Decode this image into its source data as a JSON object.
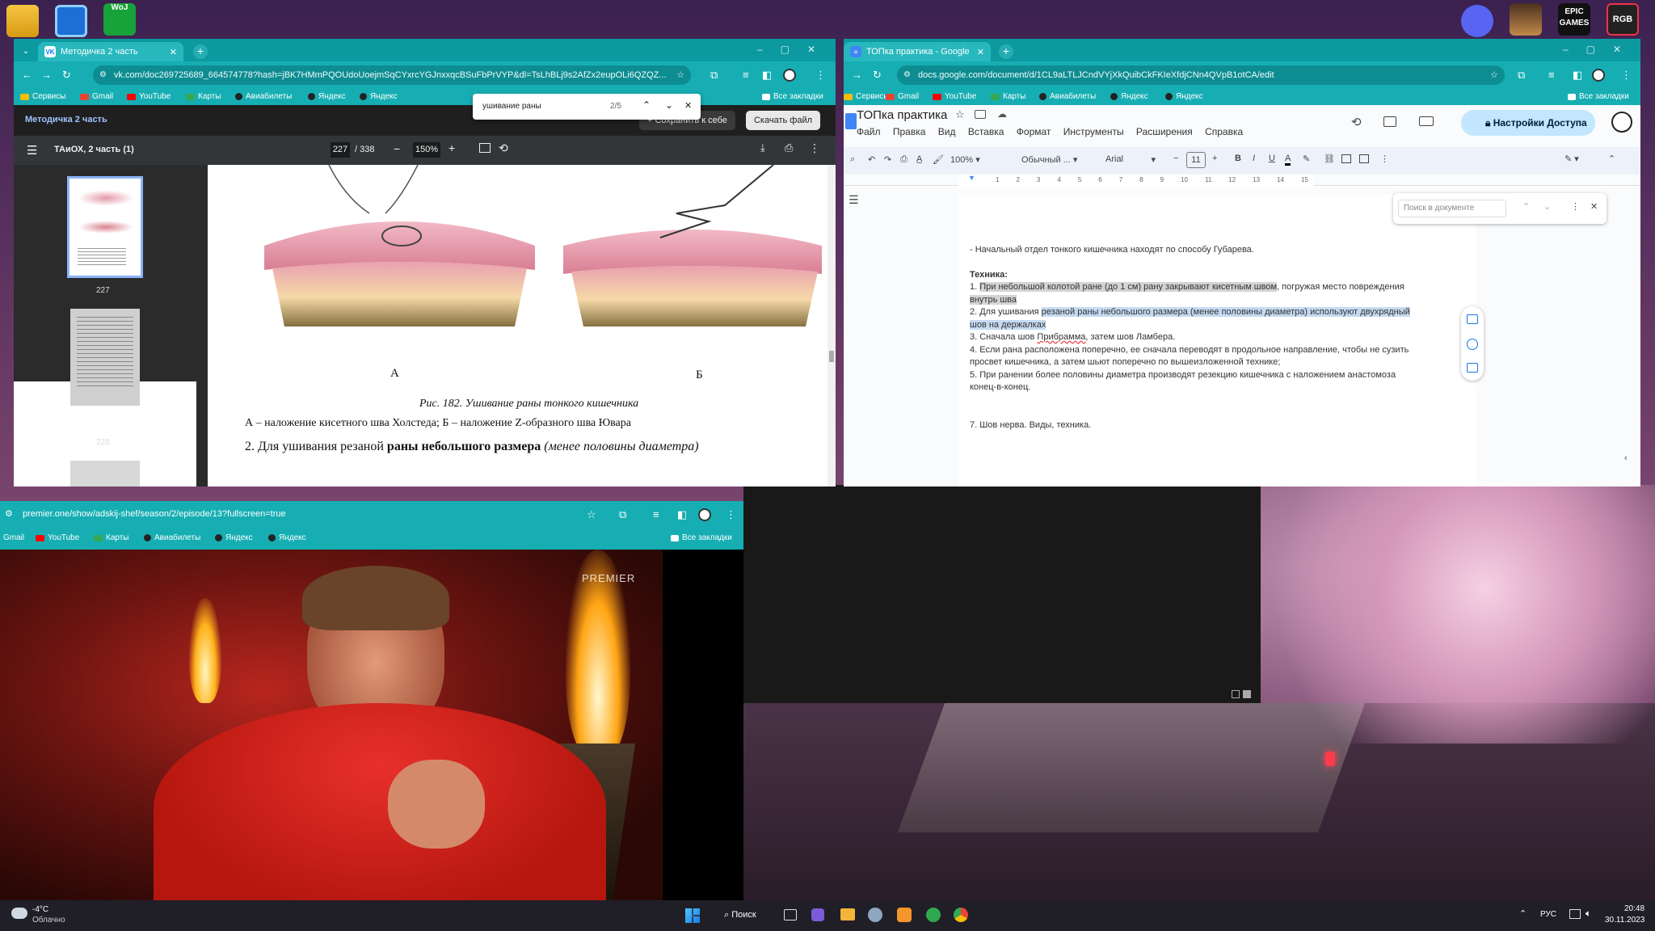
{
  "desktop": {
    "icons": [
      "folder-icon",
      "monitor-icon",
      "woj-icon",
      "discord-icon",
      "avatar-icon",
      "epic-icon",
      "rgb-icon"
    ],
    "woj_label": "WoJ",
    "epic_label": "EPIC GAMES",
    "rgb_label": "RGB"
  },
  "left_window": {
    "tab_title": "Методичка 2 часть",
    "url": "vk.com/doc269725689_664574778?hash=jBK7HMmPQOUdoUoejmSqCYxrcYGJnxxqcBSuFbPrVYP&dl=TsLhBLj9s2AfZx2eupOLi6QZQZ...",
    "bookmarks": [
      "Сервисы",
      "Gmail",
      "YouTube",
      "Карты",
      "Авиабилеты",
      "Яндекс",
      "Яндекс"
    ],
    "all_bookmarks": "Все закладки",
    "find_query": "ушивание раны",
    "find_count": "2/5",
    "doc_title": "Методичка 2 часть",
    "save_btn": "Сохранить к себе",
    "download_btn": "Скачать файл",
    "pdf_name": "ТАиОХ, 2 часть (1)",
    "page_current": "227",
    "page_total": "/ 338",
    "zoom": "150%",
    "thumbs": [
      "227",
      "228"
    ],
    "figure_label_a": "А",
    "figure_label_b": "Б",
    "caption": "Рис. 182. Ушивание раны тонкого кишечника",
    "caption_line": "А – наложение кисетного шва Холстеда; Б – наложение Z-образного шва Ювара",
    "cut_line_1": "2.   Для ушивания резаной ",
    "cut_line_bold": "раны небольшого размера",
    "cut_line_2": " (менее половины диаметра)"
  },
  "right_window": {
    "tab_title": "ТОПка практика - Google До...",
    "url": "docs.google.com/document/d/1CL9aLTLJCndVYjXkQuibCkFKIeXfdjCNn4QVpB1otCA/edit",
    "bookmarks": [
      "Сервисы",
      "Gmail",
      "YouTube",
      "Карты",
      "Авиабилеты",
      "Яндекс",
      "Яндекс"
    ],
    "all_bookmarks": "Все закладки",
    "doc_title": "ТОПка практика",
    "menu": [
      "Файл",
      "Правка",
      "Вид",
      "Вставка",
      "Формат",
      "Инструменты",
      "Расширения",
      "Справка"
    ],
    "access_btn": "Настройки Доступа",
    "zoom": "100%",
    "style": "Обычный ...",
    "font": "Arial",
    "font_size": "11",
    "search_placeholder": "Поиск в документе",
    "ruler": [
      "1",
      "2",
      "3",
      "4",
      "5",
      "6",
      "7",
      "8",
      "9",
      "10",
      "11",
      "12",
      "13",
      "14",
      "15"
    ],
    "p1": "- Начальный отдел тонкого кишечника находят по способу Губарева.",
    "heading": "Техника:",
    "l1a": "1. ",
    "l1b": "При небольшой колотой ране (до 1 см) рану закрывают кисетным швом",
    ", погружая место повреждения": "",
    "l1c": ", погружая место повреждения",
    "l1d": "внутрь шва",
    "l2a": "2. Для ушивания ",
    "l2b": "резаной раны небольшого размера (менее половины диаметра) используют двухрядный",
    "l2c": "шов на держалках",
    "l3a": "3. Сначала шов ",
    "l3b": "Прибрамма",
    ", затем шов Ламбера.": "",
    "l3c": ", затем шов Ламбера.",
    "l4a": "4. Если рана расположена поперечно, ее сначала переводят в продольное направление, чтобы не сузить",
    "l4b": "просвет кишечника, а затем шьют поперечно по вышеизложенной технике;",
    "l5a": "5. При ранении более половины диаметра производят резекцию кишечника с наложением анастомоза",
    "l5b": "конец-в-конец.",
    "l7": "7. Шов нерва. Виды, техника."
  },
  "bottom_window": {
    "url": "premier.one/show/adskij-shef/season/2/episode/13?fullscreen=true",
    "bookmarks": [
      "Gmail",
      "YouTube",
      "Карты",
      "Авиабилеты",
      "Яндекс",
      "Яндекс"
    ],
    "all_bookmarks": "Все закладки",
    "watermark": "PREMIER"
  },
  "taskbar": {
    "temp": "-4°C",
    "weather": "Облачно",
    "search": "Поиск",
    "lang": "РУС",
    "time": "20:48",
    "date": "30.11.2023"
  },
  "colors": {
    "chrome": "#16aeb3",
    "chrome_dark": "#0c9aa0",
    "shirt": "#d81e1e"
  }
}
